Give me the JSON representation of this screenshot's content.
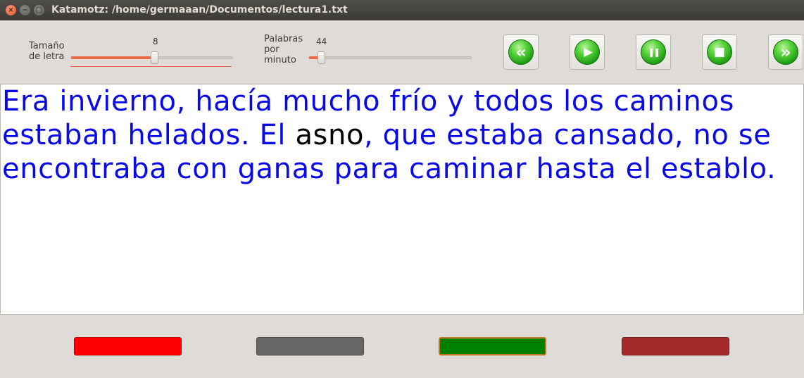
{
  "window": {
    "title": "Katamotz: /home/germaaan/Documentos/lectura1.txt",
    "close_glyph": "×",
    "minimize_glyph": "−",
    "maximize_glyph": "□"
  },
  "toolbar": {
    "font_size": {
      "label_line1": "Tamaño",
      "label_line2": "de letra",
      "value": "8",
      "level_fraction": 0.52
    },
    "words_per_minute": {
      "label_line1": "Palabras",
      "label_line2": "por",
      "label_line3": "minuto",
      "value": "44",
      "level_fraction": 0.08
    },
    "buttons": [
      {
        "name": "rewind",
        "icon": "rewind-icon",
        "glyph": "«"
      },
      {
        "name": "play",
        "icon": "play-icon",
        "glyph": "▶"
      },
      {
        "name": "pause",
        "icon": "pause-icon",
        "glyph": "❚❚"
      },
      {
        "name": "stop",
        "icon": "stop-icon",
        "glyph": "■"
      },
      {
        "name": "forward",
        "icon": "fast-forward-icon",
        "glyph": "»"
      }
    ]
  },
  "reader": {
    "text_before": "Era invierno, hacía mucho frío y todos los caminos estaban helados. El ",
    "highlighted_word": "asno",
    "text_after": ", que estaba cansado, no se encontraba con ganas para caminar hasta el establo.",
    "text_color": "#0a0ae6",
    "highlight_color": "#000000"
  },
  "color_buttons": [
    {
      "name": "red",
      "color": "#ff0000"
    },
    {
      "name": "gray",
      "color": "#666666"
    },
    {
      "name": "green",
      "color": "#008000"
    },
    {
      "name": "brown",
      "color": "#a52a2a"
    }
  ]
}
